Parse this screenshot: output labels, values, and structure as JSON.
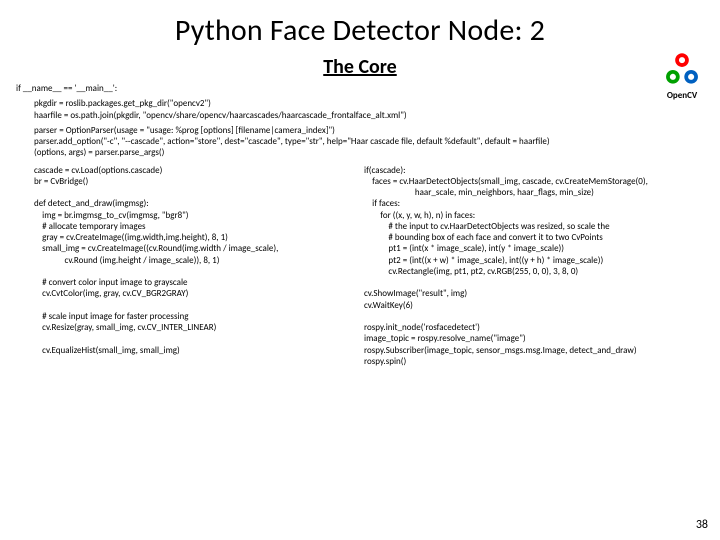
{
  "title": "Python Face Detector Node: 2",
  "subtitle": "The Core",
  "logo_label": "OpenCV",
  "page_number": "38",
  "code": {
    "top_line": "if __name__ == '__main__':",
    "block1_l1": "pkgdir = roslib.packages.get_pkg_dir(\"opencv2\")",
    "block1_l2": "haarfile = os.path.join(pkgdir, \"opencv/share/opencv/haarcascades/haarcascade_frontalface_alt.xml\")",
    "block2_l1": "parser = OptionParser(usage = \"usage: %prog [options] [filename|camera_index]\")",
    "block2_l2": "parser.add_option(\"-c\", \"--cascade\", action=\"store\", dest=\"cascade\", type=\"str\", help=\"Haar cascade file, default %default\", default = haarfile)",
    "block2_l3": "(options, args) = parser.parse_args()",
    "left": {
      "l1": "cascade = cv.Load(options.cascade)",
      "l2": "br = CvBridge()",
      "l3": "",
      "l4": "def detect_and_draw(imgmsg):",
      "l5": "    img = br.imgmsg_to_cv(imgmsg, \"bgr8\")",
      "l6": "    # allocate temporary images",
      "l7": "    gray = cv.CreateImage((img.width,img.height), 8, 1)",
      "l8": "    small_img = cv.CreateImage((cv.Round(img.width / image_scale),",
      "l9": "               cv.Round (img.height / image_scale)), 8, 1)",
      "l10": "",
      "l11": "    # convert color input image to grayscale",
      "l12": "    cv.CvtColor(img, gray, cv.CV_BGR2GRAY)",
      "l13": "",
      "l14": "    # scale input image for faster processing",
      "l15": "    cv.Resize(gray, small_img, cv.CV_INTER_LINEAR)",
      "l16": "",
      "l17": "    cv.EqualizeHist(small_img, small_img)"
    },
    "right": {
      "l1": "if(cascade):",
      "l2": "    faces = cv.HaarDetectObjects(small_img, cascade, cv.CreateMemStorage(0),",
      "l3": "                         haar_scale, min_neighbors, haar_flags, min_size)",
      "l4": "    if faces:",
      "l5": "        for ((x, y, w, h), n) in faces:",
      "l6": "            # the input to cv.HaarDetectObjects was resized, so scale the",
      "l7": "            # bounding box of each face and convert it to two CvPoints",
      "l8": "            pt1 = (int(x * image_scale), int(y * image_scale))",
      "l9": "            pt2 = (int((x + w) * image_scale), int((y + h) * image_scale))",
      "l10": "            cv.Rectangle(img, pt1, pt2, cv.RGB(255, 0, 0), 3, 8, 0)",
      "l11": "",
      "l12": "cv.ShowImage(\"result\", img)",
      "l13": "cv.WaitKey(6)",
      "l14": "",
      "l15": "rospy.init_node('rosfacedetect')",
      "l16": "image_topic = rospy.resolve_name(\"image\")",
      "l17": "rospy.Subscriber(image_topic, sensor_msgs.msg.Image, detect_and_draw)",
      "l18": "rospy.spin()"
    }
  }
}
